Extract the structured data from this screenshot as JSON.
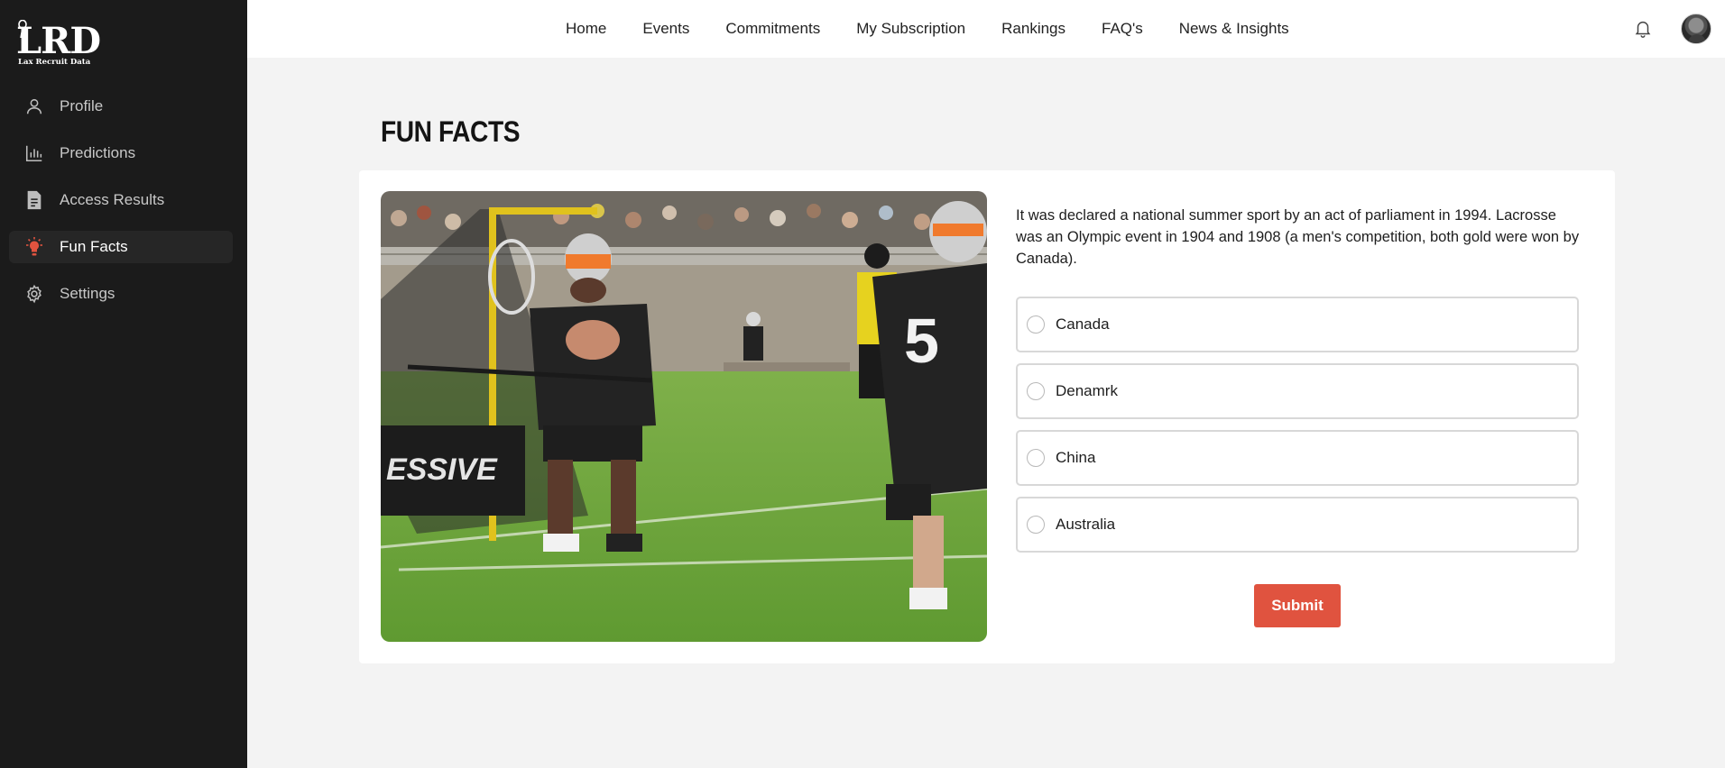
{
  "brand": {
    "logo_text": "LRD",
    "logo_subtitle": "Lax Recruit Data"
  },
  "sidebar": {
    "items": [
      {
        "label": "Profile",
        "icon": "user-icon",
        "active": false
      },
      {
        "label": "Predictions",
        "icon": "bar-chart-icon",
        "active": false
      },
      {
        "label": "Access Results",
        "icon": "document-icon",
        "active": false
      },
      {
        "label": "Fun Facts",
        "icon": "lightbulb-icon",
        "active": true
      },
      {
        "label": "Settings",
        "icon": "gear-icon",
        "active": false
      }
    ]
  },
  "topnav": {
    "links": [
      "Home",
      "Events",
      "Commitments",
      "My Subscription",
      "Rankings",
      "FAQ's",
      "News & Insights"
    ],
    "notification_icon": "bell-icon",
    "avatar_icon": "user-avatar"
  },
  "main": {
    "title": "FUN FACTS",
    "question": "It was declared a national summer sport by an act of parliament in 1994. Lacrosse was an Olympic event in 1904 and 1908 (a men's competition, both gold were won by Canada).",
    "options": [
      "Canada",
      "Denamrk",
      "China",
      "Australia"
    ],
    "submit_label": "Submit"
  },
  "colors": {
    "sidebar_bg": "#1b1b1b",
    "page_bg": "#f3f3f3",
    "accent": "#e0533f",
    "active_icon": "#e0533f"
  }
}
